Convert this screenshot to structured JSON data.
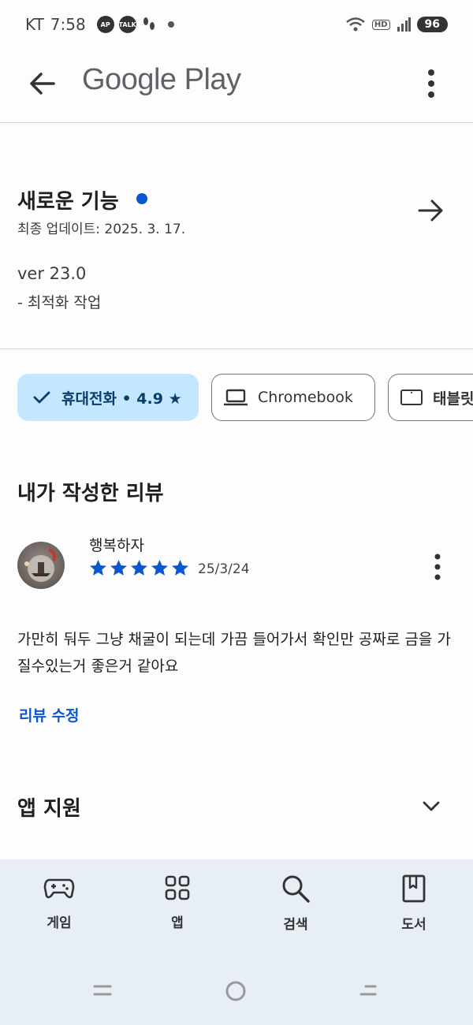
{
  "status_bar": {
    "carrier": "KT",
    "time": "7:58",
    "badges": [
      "AP",
      "TALK"
    ],
    "battery": "96"
  },
  "app_bar": {
    "title": "Google Play"
  },
  "whats_new": {
    "title": "새로운 기능",
    "last_updated": "최종 업데이트: 2025. 3. 17.",
    "version": "ver 23.0",
    "note": "- 최적화 작업"
  },
  "device_chips": {
    "phone": "휴대전화 • 4.9 ★",
    "chromebook": "Chromebook",
    "tablet": "태블릿"
  },
  "my_review": {
    "heading": "내가 작성한 리뷰",
    "reviewer": "행복하자",
    "rating": 5,
    "date": "25/3/24",
    "text": "가만히 둬두 그냥 채굴이 되는데 가끔 들어가서 확인만 공짜로 금을 가질수있는거 좋은거 같아요",
    "edit_label": "리뷰 수정"
  },
  "app_support": {
    "title": "앱 지원"
  },
  "bottom_nav": {
    "games": "게임",
    "apps": "앱",
    "search": "검색",
    "books": "도서"
  },
  "colors": {
    "accent": "#0b57d0",
    "chip_selected": "#c2e7ff",
    "nav_bg": "#e8eef5"
  },
  "icons": [
    "back-arrow-icon",
    "more-vert-icon",
    "arrow-forward-icon",
    "check-icon",
    "laptop-icon",
    "tablet-icon",
    "star-icon",
    "chevron-down-icon",
    "gamepad-icon",
    "apps-grid-icon",
    "search-icon",
    "book-icon"
  ]
}
